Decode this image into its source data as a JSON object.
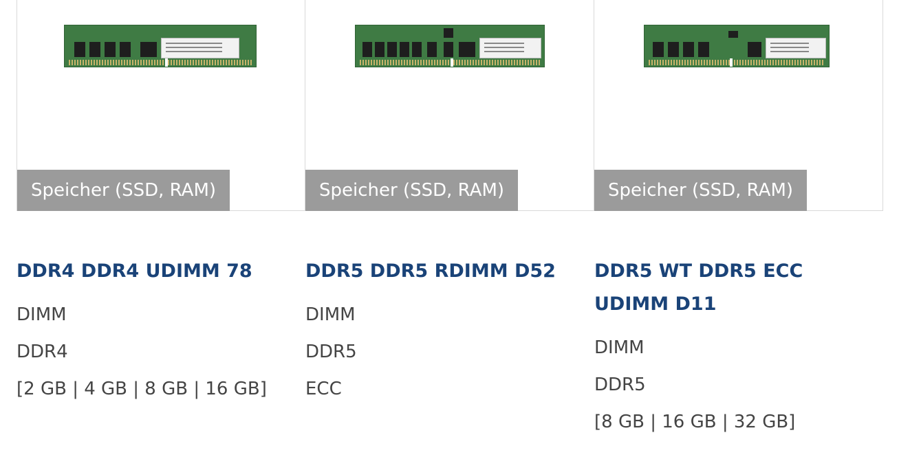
{
  "products": [
    {
      "category_badge": "Speicher (SSD, RAM)",
      "image_icon": "ram-module-ddr4-udimm-icon",
      "title": "DDR4 DDR4 UDIMM 78",
      "specs": [
        "DIMM",
        "DDR4",
        "[2 GB | 4 GB | 8 GB | 16 GB]"
      ]
    },
    {
      "category_badge": "Speicher (SSD, RAM)",
      "image_icon": "ram-module-ddr5-rdimm-icon",
      "title": "DDR5 DDR5 RDIMM D52",
      "specs": [
        "DIMM",
        "DDR5",
        "ECC"
      ]
    },
    {
      "category_badge": "Speicher (SSD, RAM)",
      "image_icon": "ram-module-ddr5-ecc-udimm-icon",
      "title": "DDR5 WT DDR5 ECC UDIMM D11",
      "specs": [
        "DIMM",
        "DDR5",
        "[8 GB | 16 GB | 32 GB]"
      ]
    }
  ],
  "colors": {
    "title": "#1a4378",
    "badge_bg": "#9b9b9b",
    "spec_text": "#444444",
    "pcb_green": "#3f7b44"
  }
}
